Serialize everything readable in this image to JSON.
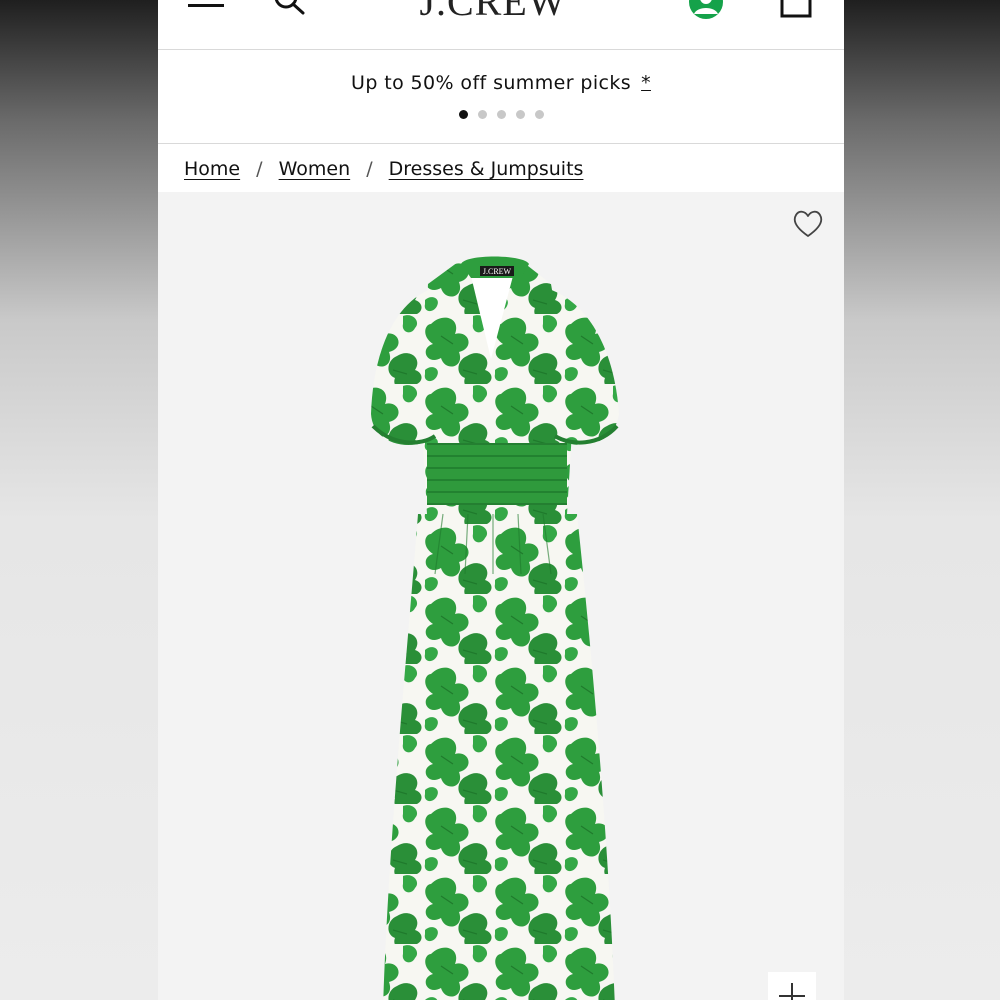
{
  "header": {
    "logo": "J.CREW",
    "icons": [
      "menu-icon",
      "search-icon",
      "account-icon",
      "shopping-bag-icon"
    ],
    "account_icon_color": "#15a24a"
  },
  "promo": {
    "text": "Up to 50% off summer picks",
    "details_link": "*",
    "slides_total": 5,
    "active_slide": 1
  },
  "breadcrumb": {
    "items": [
      "Home",
      "Women",
      "Dresses & Jumpsuits"
    ],
    "separator": "/"
  },
  "product": {
    "image_label": "J.CREW",
    "print_colors": [
      "#2e9e3e",
      "#f7f7f2"
    ],
    "icons": [
      "heart-icon",
      "plus-icon"
    ]
  }
}
